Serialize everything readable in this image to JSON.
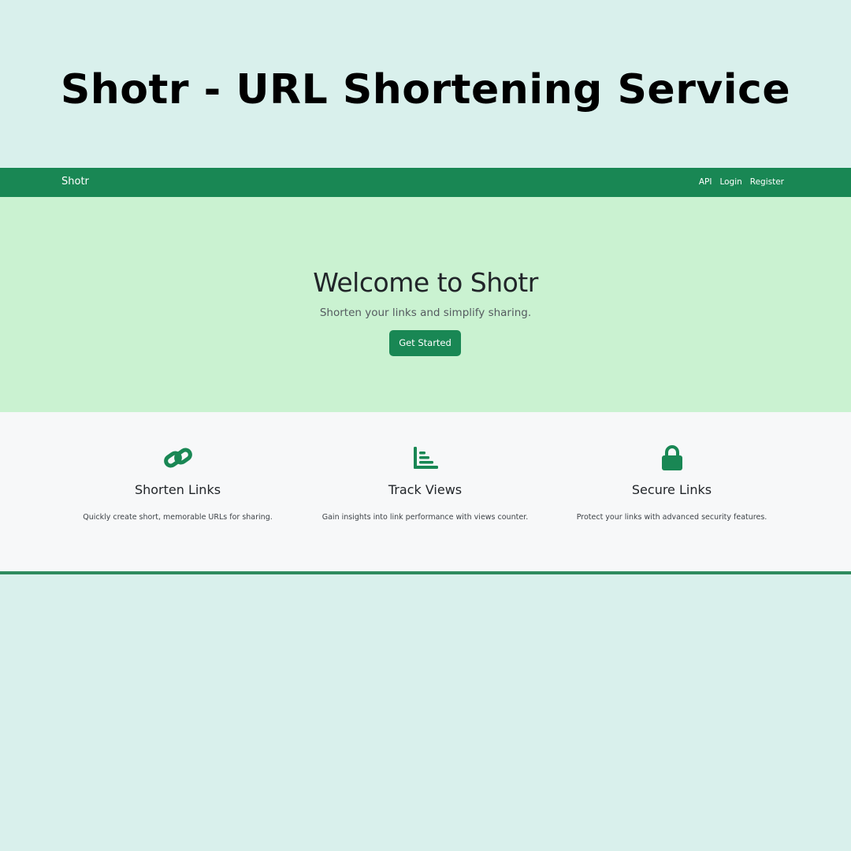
{
  "poster": {
    "title": "Shotr - URL Shortening Service"
  },
  "navbar": {
    "brand": "Shotr",
    "links": [
      "API",
      "Login",
      "Register"
    ]
  },
  "hero": {
    "title": "Welcome to Shotr",
    "subtitle": "Shorten your links and simplify sharing.",
    "button_label": "Get Started"
  },
  "features": [
    {
      "icon": "link-icon",
      "title": "Shorten Links",
      "description": "Quickly create short, memorable URLs for sharing."
    },
    {
      "icon": "chart-bar-icon",
      "title": "Track Views",
      "description": "Gain insights into link performance with views counter."
    },
    {
      "icon": "lock-icon",
      "title": "Secure Links",
      "description": "Protect your links with advanced security features."
    }
  ],
  "colors": {
    "page_background": "#d9f0ec",
    "navbar": "#198754",
    "hero_background": "#caf2d1",
    "features_background": "#f7f8f9",
    "accent": "#198754"
  }
}
